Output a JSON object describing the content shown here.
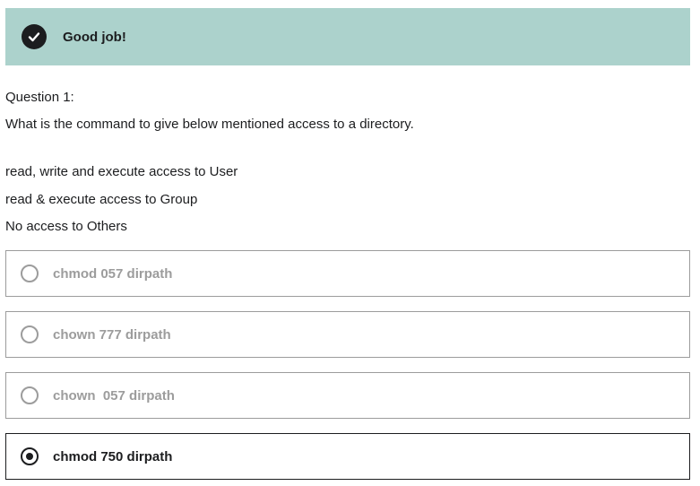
{
  "feedback": {
    "icon": "check-circle-icon",
    "message": "Good job!",
    "color": "#acd2cc"
  },
  "question": {
    "label": "Question 1:",
    "prompt": "What is the command to give below mentioned access to a directory.",
    "requirements": [
      "read, write and execute access to User",
      "read & execute access to Group",
      "No access to Others"
    ]
  },
  "options": [
    {
      "label": "chmod 057 dirpath",
      "selected": false
    },
    {
      "label": "chown 777 dirpath",
      "selected": false
    },
    {
      "label": "chown  057 dirpath",
      "selected": false
    },
    {
      "label": "chmod 750 dirpath",
      "selected": true
    }
  ]
}
